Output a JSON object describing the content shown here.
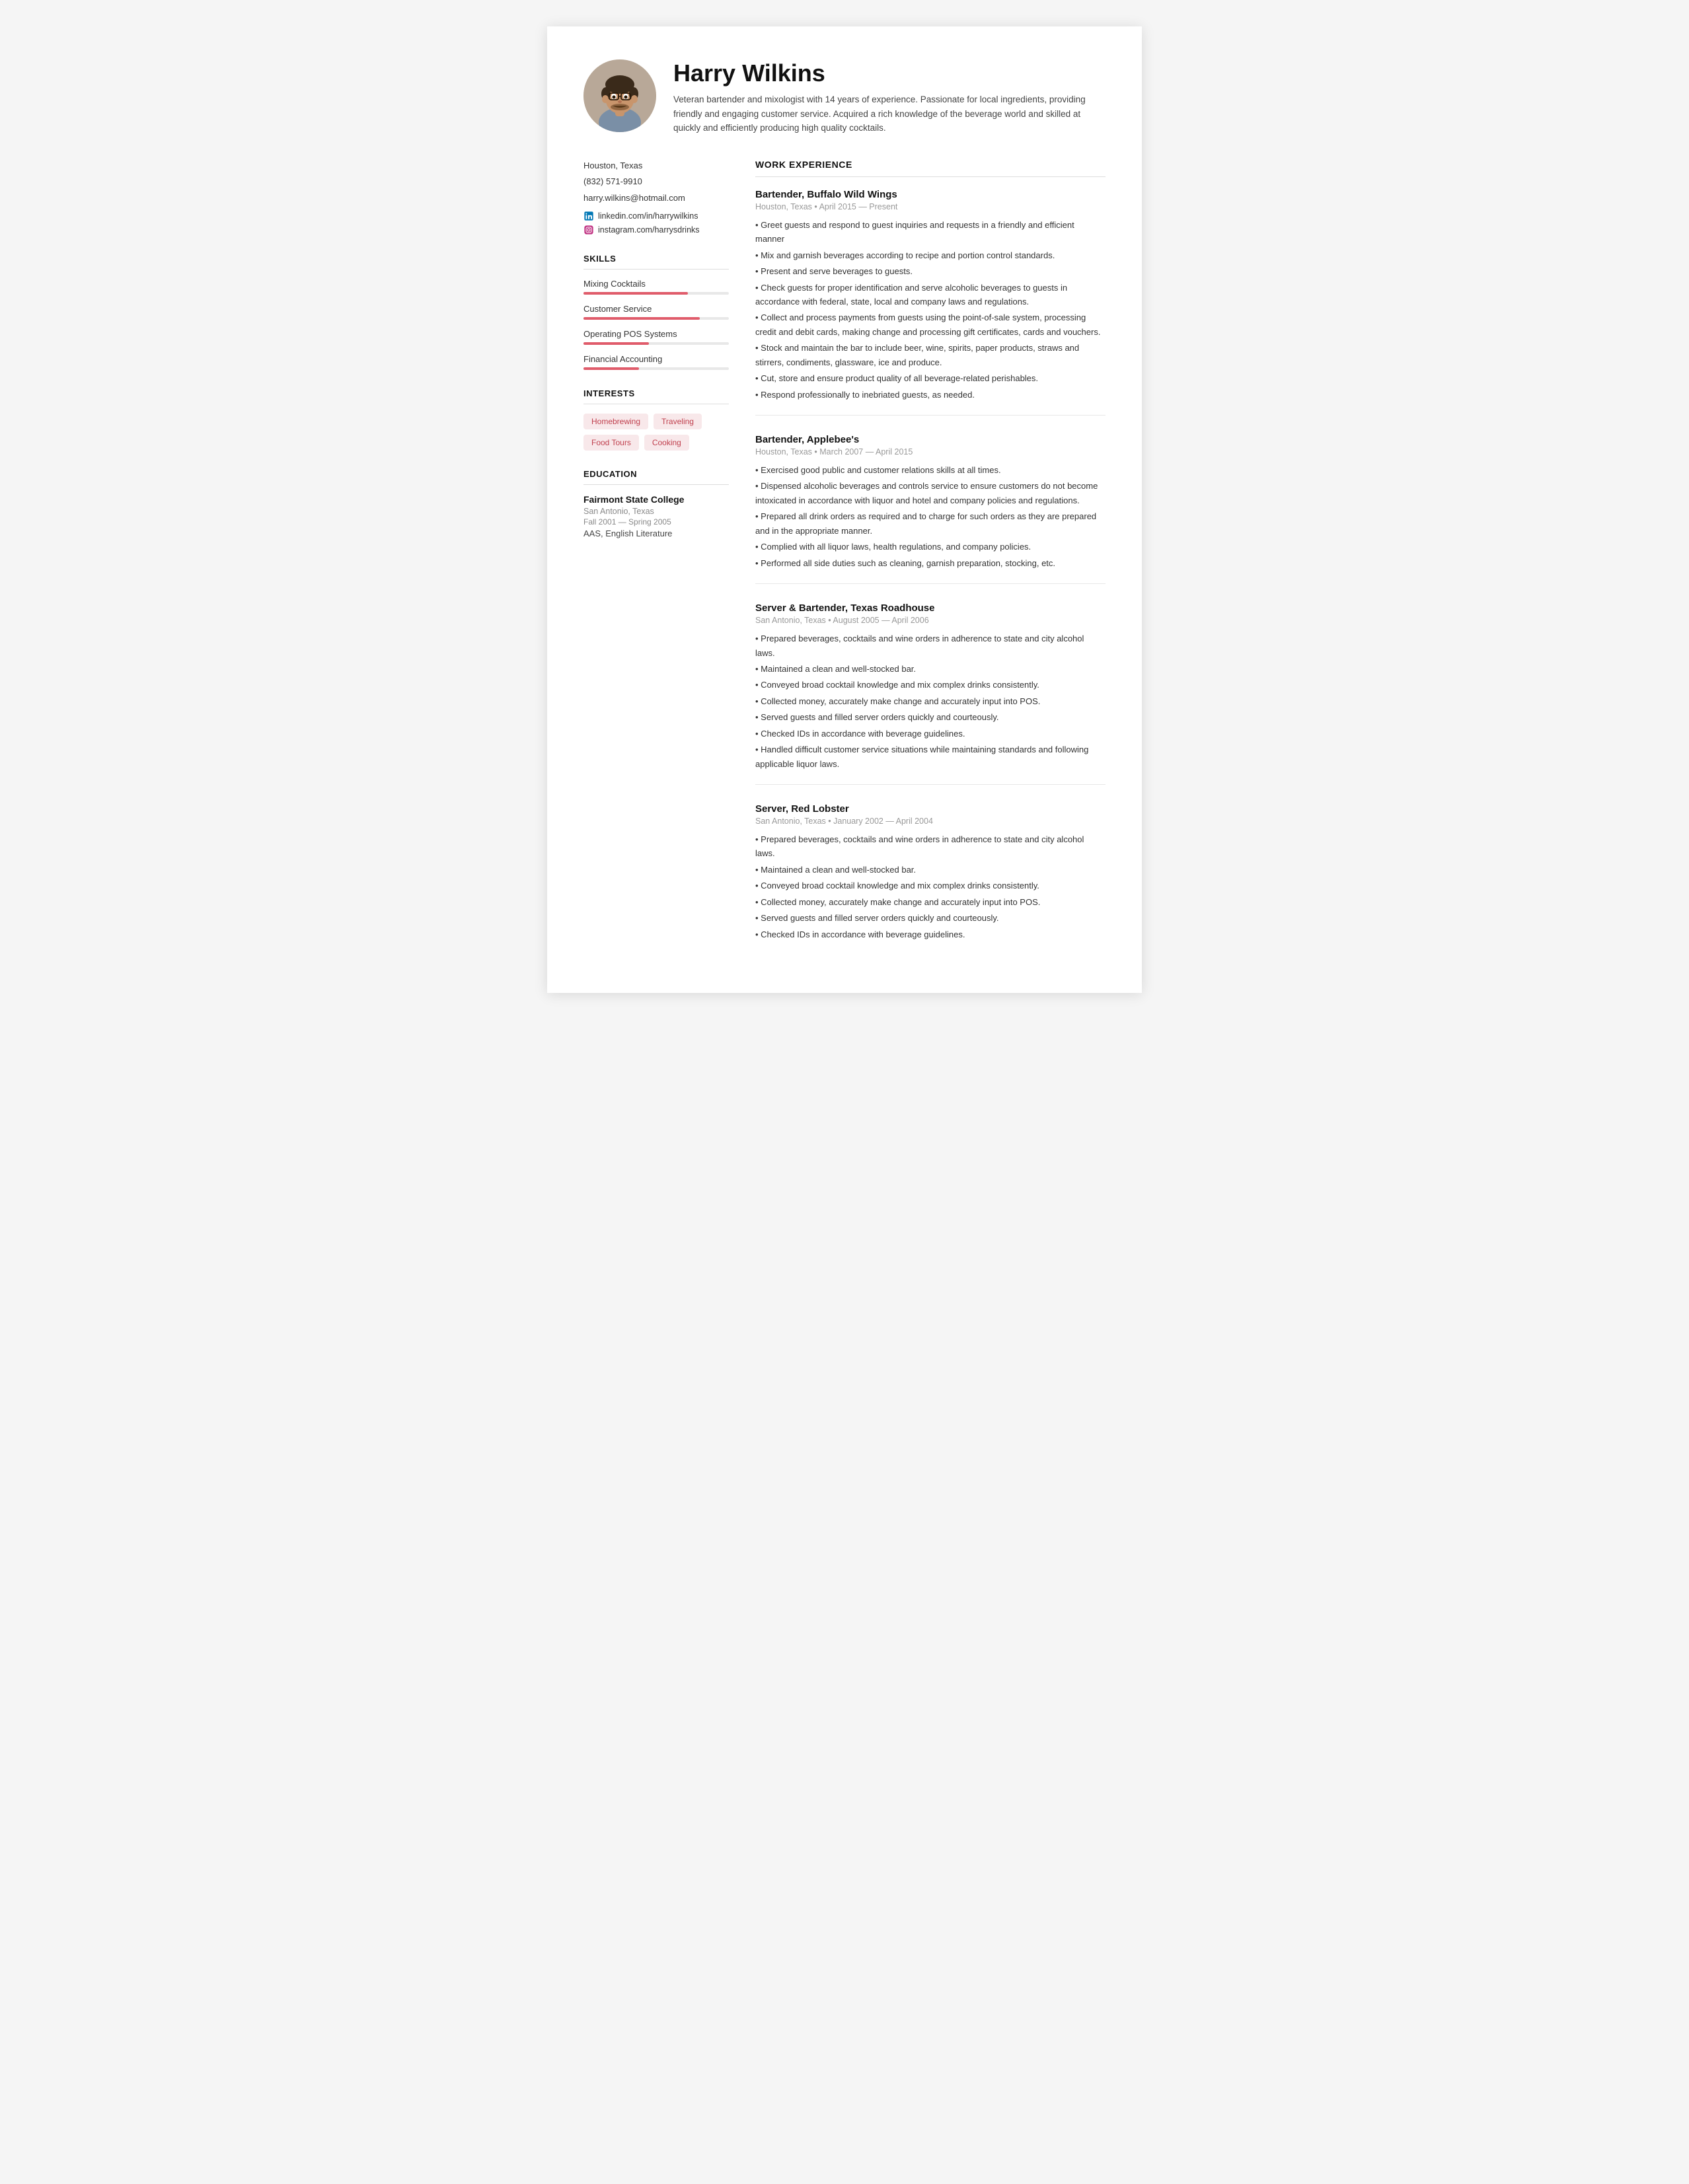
{
  "header": {
    "name": "Harry Wilkins",
    "summary": "Veteran bartender and mixologist with 14 years of experience. Passionate for local ingredients, providing friendly and engaging customer service. Acquired a rich knowledge of the beverage world and skilled at quickly and efficiently producing high quality cocktails."
  },
  "contact": {
    "location": "Houston, Texas",
    "phone": "(832) 571-9910",
    "email": "harry.wilkins@hotmail.com",
    "linkedin": "linkedin.com/in/harrywilkins",
    "instagram": "instagram.com/harrysdrinks"
  },
  "skills_title": "SKILLS",
  "skills": [
    {
      "name": "Mixing Cocktails",
      "pct": 72
    },
    {
      "name": "Customer Service",
      "pct": 80
    },
    {
      "name": "Operating POS Systems",
      "pct": 45
    },
    {
      "name": "Financial Accounting",
      "pct": 38
    }
  ],
  "interests_title": "INTERESTS",
  "interests": [
    "Homebrewing",
    "Traveling",
    "Food Tours",
    "Cooking"
  ],
  "education_title": "EDUCATION",
  "education": {
    "school": "Fairmont State College",
    "location": "San Antonio, Texas",
    "dates": "Fall 2001 — Spring 2005",
    "degree": "AAS, English Literature"
  },
  "work_title": "WORK EXPERIENCE",
  "jobs": [
    {
      "title": "Bartender, Buffalo Wild Wings",
      "meta": "Houston, Texas • April 2015 — Present",
      "bullets": [
        "• Greet guests and respond to guest inquiries and requests in a friendly and efficient manner",
        "• Mix and garnish beverages according to recipe and portion control standards.",
        "• Present and serve beverages to guests.",
        "• Check guests for proper identification and serve alcoholic beverages to guests in accordance with federal, state, local and company laws and regulations.",
        "• Collect and process payments from guests using the point-of-sale system, processing credit and debit cards, making change and processing gift certificates, cards and vouchers.",
        "• Stock and maintain the bar to include beer, wine, spirits, paper products, straws and stirrers, condiments, glassware, ice and produce.",
        "• Cut, store and ensure product quality of all beverage-related perishables.",
        "• Respond professionally to inebriated guests, as needed."
      ]
    },
    {
      "title": "Bartender, Applebee's",
      "meta": "Houston, Texas • March 2007 — April 2015",
      "bullets": [
        "• Exercised good public and customer relations skills at all times.",
        "• Dispensed alcoholic beverages and controls service to ensure customers do not become intoxicated in accordance with liquor and hotel and company policies and regulations.",
        "• Prepared all drink orders as required and to charge for such orders as they are prepared and in the appropriate manner.",
        "• Complied with all liquor laws, health regulations, and company policies.",
        "• Performed all side duties such as cleaning, garnish preparation, stocking, etc."
      ]
    },
    {
      "title": "Server & Bartender, Texas Roadhouse",
      "meta": "San Antonio, Texas • August 2005 — April 2006",
      "bullets": [
        "• Prepared beverages, cocktails and wine orders in adherence to state and city alcohol laws.",
        "• Maintained a clean and well-stocked bar.",
        "• Conveyed broad cocktail knowledge and mix complex drinks consistently.",
        "• Collected money, accurately make change and accurately input into POS.",
        "• Served guests and filled server orders quickly and courteously.",
        "• Checked IDs in accordance with beverage guidelines.",
        "• Handled difficult customer service situations while maintaining standards and following applicable liquor laws."
      ]
    },
    {
      "title": "Server, Red Lobster",
      "meta": "San Antonio, Texas • January 2002 — April 2004",
      "bullets": [
        "• Prepared beverages, cocktails and wine orders in adherence to state and city alcohol laws.",
        "• Maintained a clean and well-stocked bar.",
        "• Conveyed broad cocktail knowledge and mix complex drinks consistently.",
        "• Collected money, accurately make change and accurately input into POS.",
        "• Served guests and filled server orders quickly and courteously.",
        "• Checked IDs in accordance with beverage guidelines."
      ]
    }
  ]
}
